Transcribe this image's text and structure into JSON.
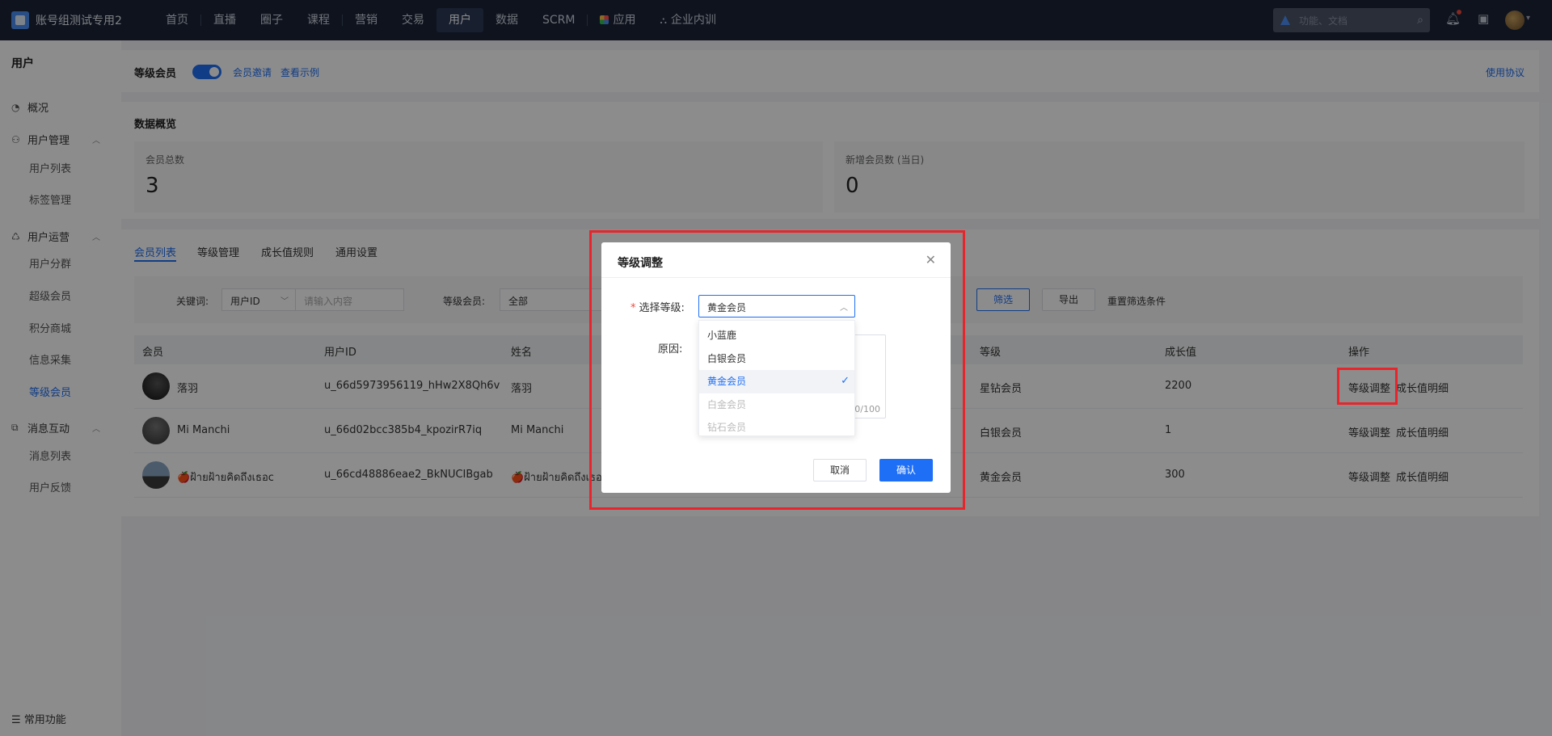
{
  "topbar": {
    "brand": "账号组测试专用2",
    "nav": [
      "首页",
      "直播",
      "圈子",
      "课程",
      "营销",
      "交易",
      "用户",
      "数据",
      "SCRM",
      "应用",
      "企业内训"
    ],
    "active_nav": "用户",
    "search_placeholder": "功能、文档"
  },
  "sidebar": {
    "title": "用户",
    "overview": "概况",
    "groups": {
      "user_mgmt": "用户管理",
      "user_ops": "用户运营",
      "msg": "消息互动"
    },
    "items": {
      "user_list": "用户列表",
      "tag_mgmt": "标签管理",
      "segments": "用户分群",
      "super_member": "超级会员",
      "points_mall": "积分商城",
      "info_collect": "信息采集",
      "level_member": "等级会员",
      "msg_list": "消息列表",
      "feedback": "用户反馈"
    },
    "bottom": "常用功能"
  },
  "header": {
    "title": "等级会员",
    "invite_link": "会员邀请",
    "example_link": "查看示例",
    "agreement_link": "使用协议"
  },
  "overview": {
    "title": "数据概览",
    "total_label": "会员总数",
    "total_value": "3",
    "new_label": "新增会员数 (当日)",
    "new_value": "0"
  },
  "tabs": [
    "会员列表",
    "等级管理",
    "成长值规则",
    "通用设置"
  ],
  "filter": {
    "keyword_label": "关键词:",
    "keyword_type": "用户ID",
    "keyword_placeholder": "请输入内容",
    "level_label": "等级会员:",
    "level_value": "全部",
    "filter_btn": "筛选",
    "export_btn": "导出",
    "reset_link": "重置筛选条件"
  },
  "table": {
    "headers": [
      "会员",
      "用户ID",
      "姓名",
      "等级",
      "成长值",
      "操作"
    ],
    "rows": [
      {
        "member": "落羽",
        "uid": "u_66d5973956119_hHw2X8Qh6v",
        "name": "落羽",
        "level": "星钻会员",
        "growth": "2200",
        "op1": "等级调整",
        "op2": "成长值明细"
      },
      {
        "member": "Mi Manchi",
        "uid": "u_66d02bcc385b4_kpozirR7iq",
        "name": "Mi Manchi",
        "level": "白银会员",
        "growth": "1",
        "op1": "等级调整",
        "op2": "成长值明细"
      },
      {
        "member": "🍎ฝ้ายฝ้ายคิดถึงเธอc",
        "uid": "u_66cd48886eae2_BkNUCIBgab",
        "name": "🍎ฝ้ายฝ้ายคิดถึงเธอc",
        "level": "黄金会员",
        "growth": "300",
        "op1": "等级调整",
        "op2": "成长值明细"
      }
    ]
  },
  "modal": {
    "title": "等级调整",
    "select_label": "选择等级:",
    "selected_value": "黄金会员",
    "reason_label": "原因:",
    "count": "0/100",
    "options": [
      "小蓝鹿",
      "白银会员",
      "黄金会员",
      "白金会员",
      "钻石会员"
    ],
    "cancel": "取消",
    "confirm": "确认"
  },
  "colors": {
    "accent": "#1e6ff5",
    "topbar": "#1b2438",
    "highlight": "#e8252a"
  }
}
